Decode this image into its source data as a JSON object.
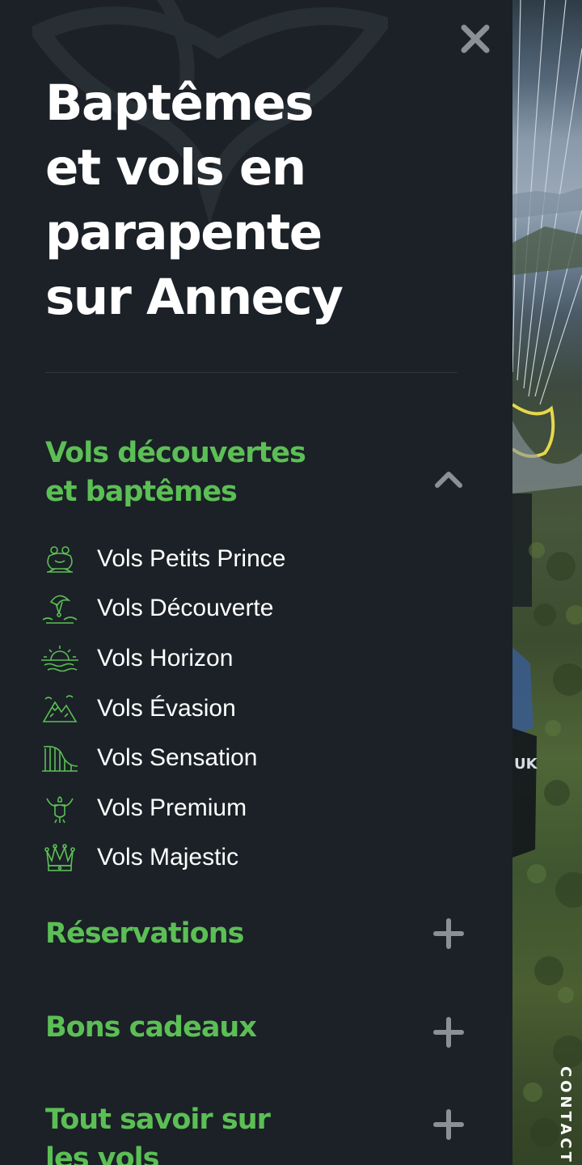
{
  "menu": {
    "title_lines": [
      "Baptêmes",
      "et vols en",
      "parapente",
      "sur Annecy"
    ],
    "close_icon": "close-icon",
    "sections": [
      {
        "title_lines": [
          "Vols découvertes",
          "et baptêmes"
        ],
        "state": "expanded",
        "toggle_icon": "chevron-up-icon",
        "items": [
          {
            "label": "Vols Petits Prince",
            "icon": "frog-icon"
          },
          {
            "label": "Vols Découverte",
            "icon": "paraglider-icon"
          },
          {
            "label": "Vols Horizon",
            "icon": "sunset-icon"
          },
          {
            "label": "Vols Évasion",
            "icon": "mountains-icon"
          },
          {
            "label": "Vols Sensation",
            "icon": "rollercoaster-icon"
          },
          {
            "label": "Vols Premium",
            "icon": "eagle-icon"
          },
          {
            "label": "Vols Majestic",
            "icon": "crown-icon"
          }
        ]
      },
      {
        "title_lines": [
          "Réservations"
        ],
        "state": "collapsed",
        "toggle_icon": "plus-icon"
      },
      {
        "title_lines": [
          "Bons cadeaux"
        ],
        "state": "collapsed",
        "toggle_icon": "plus-icon"
      },
      {
        "title_lines": [
          "Tout savoir sur",
          "les vols"
        ],
        "state": "collapsed",
        "toggle_icon": "plus-icon"
      }
    ]
  },
  "contact_tab": {
    "label": "CONTACTE"
  },
  "colors": {
    "panel_background": "#1b2127",
    "accent_green": "#5cbf55",
    "text_white": "#ffffff",
    "toggle_gray": "#8a9096"
  }
}
